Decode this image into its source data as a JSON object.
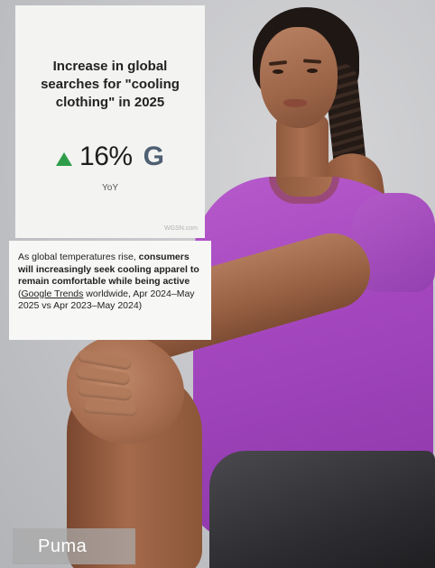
{
  "card": {
    "title_line1": "Increase in global",
    "title_line2": "searches for \"cooling",
    "title_line3": "clothing\" in 2025",
    "stat_value": "16%",
    "stat_logo": "G",
    "stat_caption": "YoY",
    "watermark": "WGSN.com",
    "trend_icon": "up-triangle-icon",
    "trend_color": "#2e9d4a"
  },
  "note": {
    "line1": "As global temperatures rise,",
    "bold_text": "consumers will increasingly seek cooling apparel to remain comfortable while being active",
    "open_paren": "(",
    "link_text": "Google Trends",
    "rest": " worldwide, Apr 2024–May 2025 vs Apr 2023–May 2024)"
  },
  "brand": {
    "label": "Puma"
  },
  "colors": {
    "shirt": "#a447bf",
    "background": "#c6c7ca",
    "card": "#f3f3f1"
  }
}
